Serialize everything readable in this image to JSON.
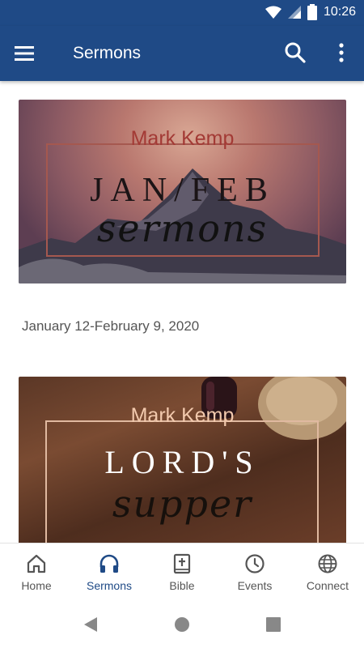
{
  "status_bar": {
    "time": "10:26"
  },
  "app_bar": {
    "title": "Sermons",
    "menu_icon": "hamburger-menu-icon",
    "search_icon": "search-icon",
    "more_icon": "more-vert-icon"
  },
  "sermons": [
    {
      "image_author": "Mark Kemp",
      "image_heading": "JAN/FEB",
      "image_script": "sermons",
      "date_range": "January 12-February 9, 2020"
    },
    {
      "image_author": "Mark Kemp",
      "image_heading": "LORD'S",
      "image_script": "supper"
    }
  ],
  "bottom_nav": [
    {
      "label": "Home",
      "icon": "home-icon",
      "active": false
    },
    {
      "label": "Sermons",
      "icon": "headphones-icon",
      "active": true
    },
    {
      "label": "Bible",
      "icon": "bible-icon",
      "active": false
    },
    {
      "label": "Events",
      "icon": "clock-icon",
      "active": false
    },
    {
      "label": "Connect",
      "icon": "globe-icon",
      "active": false
    }
  ],
  "colors": {
    "primary": "#1f4a86",
    "nav_inactive": "#555555"
  }
}
